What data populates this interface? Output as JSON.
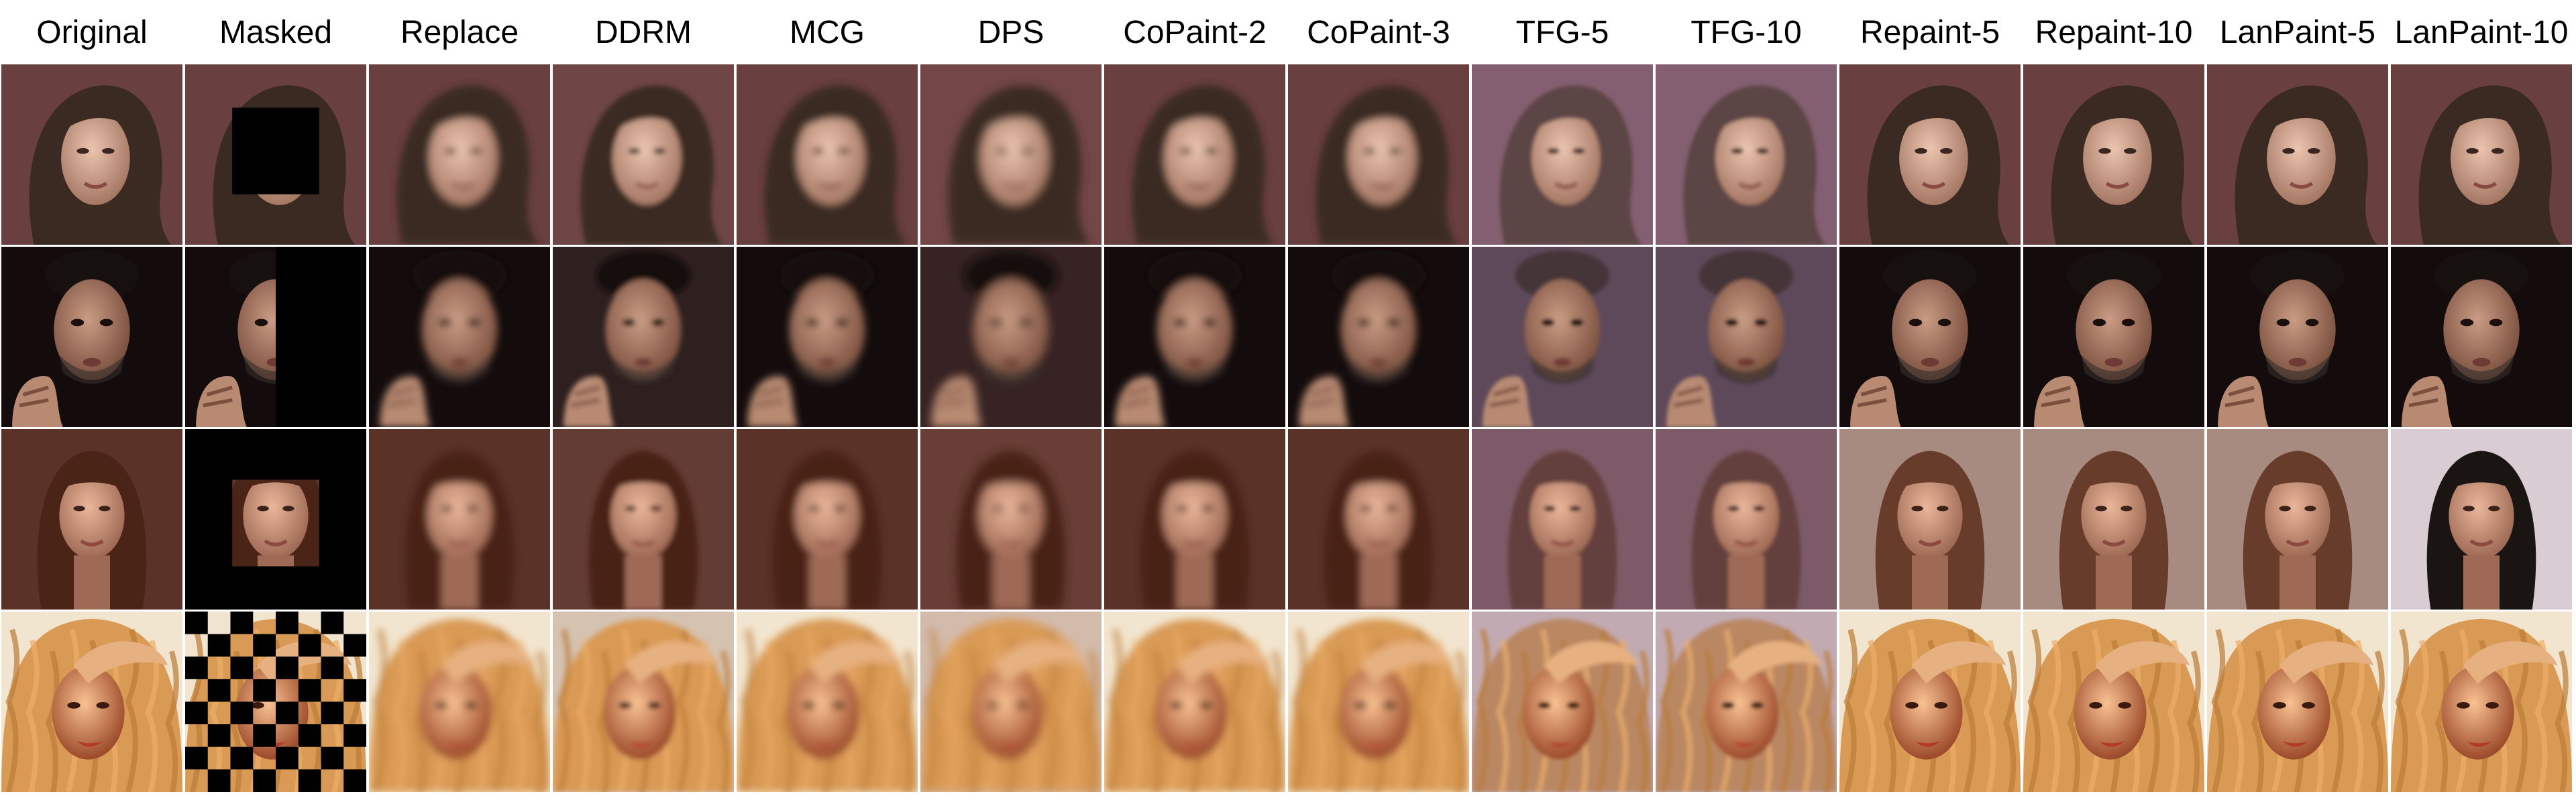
{
  "columns": [
    "Original",
    "Masked",
    "Replace",
    "DDRM",
    "MCG",
    "DPS",
    "CoPaint-2",
    "CoPaint-3",
    "TFG-5",
    "TFG-10",
    "Repaint-5",
    "Repaint-10",
    "LanPaint-5",
    "LanPaint-10"
  ],
  "rows": [
    {
      "name": "row-1-woman-dark-hair",
      "mask": "center-box",
      "palette": {
        "bg": "#6a3f3f",
        "hair": "#3a2a22",
        "skin": "#d9b29d",
        "shade": "#a57864"
      }
    },
    {
      "name": "row-2-man-hand",
      "mask": "right-half",
      "palette": {
        "bg": "#140c0c",
        "hair": "#16100e",
        "skin": "#b88a72",
        "shade": "#7a4f3e"
      }
    },
    {
      "name": "row-3-woman-brown-hair",
      "mask": "outer-frame",
      "palette": {
        "bg": "#5a3228",
        "hair": "#4a2416",
        "skin": "#d8a488",
        "shade": "#9f6a55"
      }
    },
    {
      "name": "row-4-blonde-woman",
      "mask": "checkerboard",
      "palette": {
        "bg": "#f2e5cf",
        "hair": "#d99a55",
        "skin": "#e7b080",
        "shade": "#9c4a2a"
      }
    }
  ],
  "variants": {
    "Original": {
      "blur": 0,
      "fill": "original"
    },
    "Masked": {
      "blur": 0,
      "fill": "mask"
    },
    "Replace": {
      "blur": 6,
      "fill": "blurry"
    },
    "DDRM": {
      "blur": 4,
      "fill": "smooth"
    },
    "MCG": {
      "blur": 6,
      "fill": "blurry"
    },
    "DPS": {
      "blur": 7,
      "fill": "pinkish"
    },
    "CoPaint-2": {
      "blur": 6,
      "fill": "blurry"
    },
    "CoPaint-3": {
      "blur": 6,
      "fill": "blurry"
    },
    "TFG-5": {
      "blur": 3,
      "fill": "lilac"
    },
    "TFG-10": {
      "blur": 3,
      "fill": "lilac"
    },
    "Repaint-5": {
      "blur": 0,
      "fill": "sharp"
    },
    "Repaint-10": {
      "blur": 0,
      "fill": "sharp"
    },
    "LanPaint-5": {
      "blur": 0,
      "fill": "sharp"
    },
    "LanPaint-10": {
      "blur": 0,
      "fill": "sharp-alt"
    }
  }
}
